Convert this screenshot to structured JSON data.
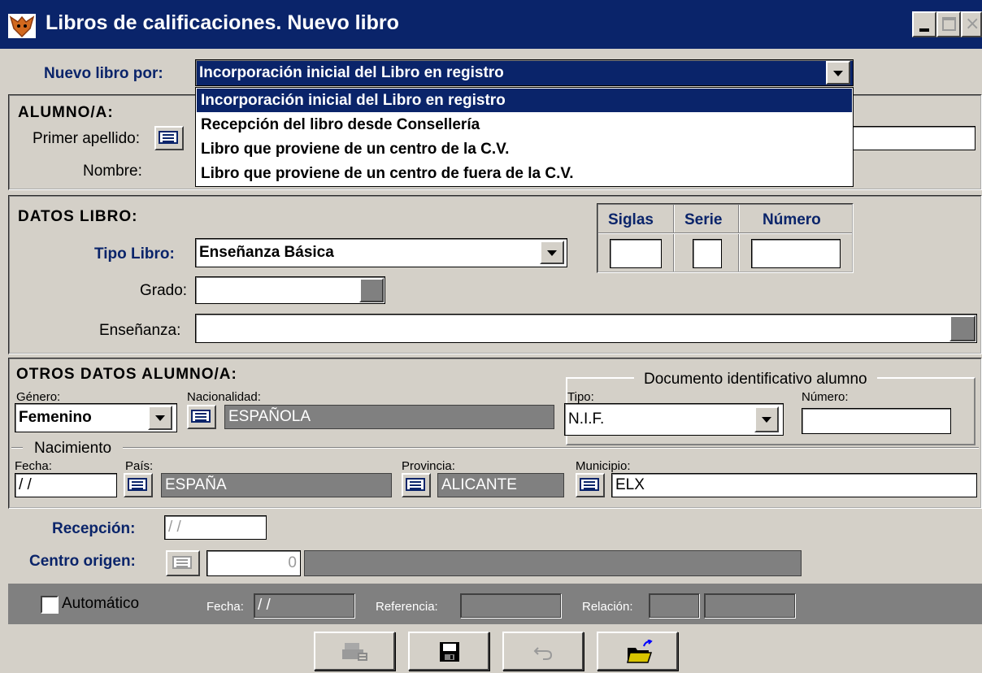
{
  "window": {
    "title": "Libros de calificaciones. Nuevo libro"
  },
  "nuevo_libro": {
    "label": "Nuevo libro por:",
    "value": "Incorporación inicial del Libro en registro",
    "options": [
      "Incorporación inicial del Libro en registro",
      "Recepción del libro desde Consellería",
      "Libro que proviene de un centro de la C.V.",
      "Libro que proviene de un centro de fuera de la C.V."
    ]
  },
  "alumno": {
    "title": "ALUMNO/A:",
    "primer_apellido_label": "Primer apellido:",
    "nombre_label": "Nombre:",
    "primer_apellido_value": "",
    "nombre_value": ""
  },
  "datos_libro": {
    "title": "DATOS LIBRO:",
    "tipo_libro_label": "Tipo Libro:",
    "tipo_libro_value": "Enseñanza Básica",
    "grado_label": "Grado:",
    "grado_value": "",
    "ensenanza_label": "Enseñanza:",
    "ensenanza_value": "",
    "siglas_label": "Siglas",
    "serie_label": "Serie",
    "numero_label": "Número"
  },
  "otros_datos": {
    "title": "OTROS DATOS ALUMNO/A:",
    "genero_label": "Género:",
    "genero_value": "Femenino",
    "nacionalidad_label": "Nacionalidad:",
    "nacionalidad_value": "ESPAÑOLA",
    "documento_title": "Documento identificativo alumno",
    "doc_tipo_label": "Tipo:",
    "doc_tipo_value": "N.I.F.",
    "doc_numero_label": "Número:",
    "doc_numero_value": "",
    "nacimiento_title": "Nacimiento",
    "fecha_label": "Fecha:",
    "fecha_value": " /  /",
    "pais_label": "País:",
    "pais_value": "ESPAÑA",
    "provincia_label": "Provincia:",
    "provincia_value": "ALICANTE",
    "municipio_label": "Municipio:",
    "municipio_value": "ELX"
  },
  "recepcion": {
    "label": "Recepción:",
    "value": " /  /",
    "centro_origen_label": "Centro origen:",
    "centro_origen_code": "0",
    "centro_origen_name": ""
  },
  "automatico": {
    "checkbox_label": "Automático",
    "fecha_label": "Fecha:",
    "fecha_value": " /  /",
    "referencia_label": "Referencia:",
    "relacion_label": "Relación:"
  },
  "toolbar": {
    "buttons": [
      "print-disabled",
      "save",
      "undo-disabled",
      "open-folder"
    ]
  },
  "colors": {
    "titlebar": "#0a246a",
    "face": "#d4d0c8",
    "label_blue": "#0a246a",
    "disabled_field": "#808080"
  }
}
